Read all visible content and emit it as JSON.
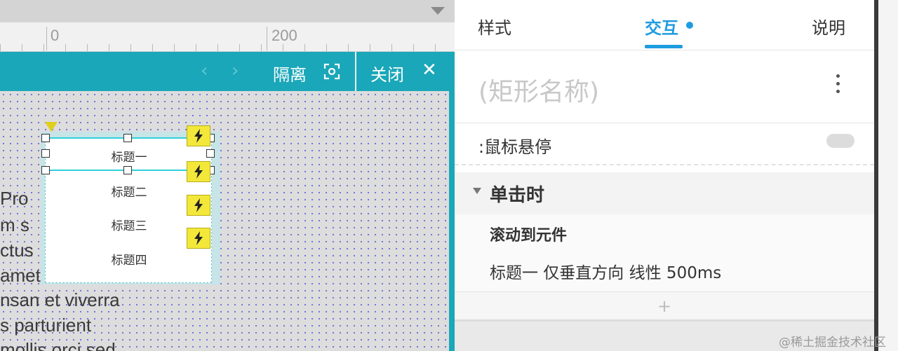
{
  "ruler": {
    "mark_0": "0",
    "mark_200": "200"
  },
  "frame_header": {
    "prev_symbol": "‹",
    "next_symbol": "›",
    "isolate_label": "隔离",
    "close_label": "关闭",
    "close_symbol": "✕"
  },
  "canvas_text_lines": [
    "Pro",
    "m s",
    "ctus",
    "amet",
    "nsan et viverra",
    "s parturient",
    "mollis orci sed"
  ],
  "list_widget": {
    "rows": [
      "标题一",
      "标题二",
      "标题三",
      "标题四"
    ]
  },
  "inspector": {
    "tabs": {
      "style": "样式",
      "interaction": "交互",
      "notes": "说明"
    },
    "name_placeholder": "(矩形名称)",
    "hover_state": ":鼠标悬停",
    "event_title": "单击时",
    "action_title": "滚动到元件",
    "action_detail": "标题一 仅垂直方向 线性 500ms",
    "add_symbol": "+"
  },
  "watermark": "@稀土掘金技术社区",
  "colors": {
    "frame_teal": "#1aa7b9",
    "accent_blue": "#1e9ce0",
    "bolt_yellow": "#f3e83a"
  }
}
